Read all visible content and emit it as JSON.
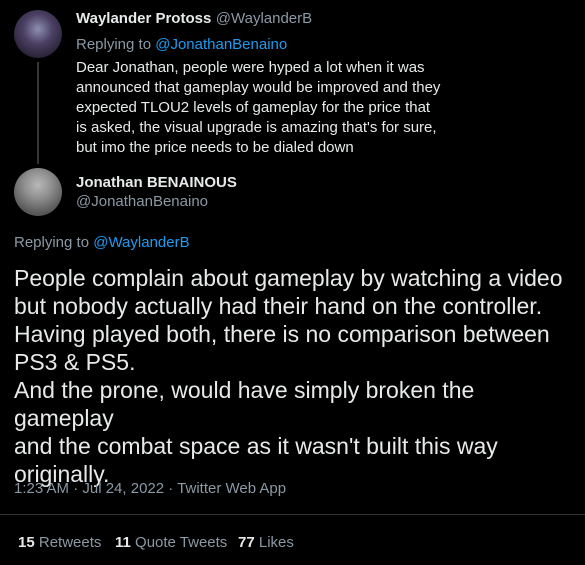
{
  "parent": {
    "name": "Waylander Protoss",
    "handle": "@WaylanderB",
    "replying_prefix": "Replying to ",
    "replying_to": "@JonathanBenaino",
    "text_lines": [
      "Dear Jonathan, people were hyped a lot when it was",
      "announced that gameplay would be improved and they",
      "expected TLOU2 levels of gameplay for the price that",
      "is asked, the visual upgrade is amazing that's for sure,",
      "but imo the price needs to be dialed down"
    ]
  },
  "main": {
    "name": "Jonathan BENAINOUS",
    "handle": "@JonathanBenaino",
    "replying_prefix": "Replying to ",
    "replying_to": "@WaylanderB",
    "text_lines": [
      "People complain about gameplay by watching a video",
      "but nobody actually had their hand on the controller.",
      "Having played both, there is no comparison between",
      "PS3 & PS5.",
      "And the prone, would have simply broken the gameplay",
      "and the combat space as it wasn't built this way",
      "originally."
    ],
    "timestamp": "1:23 AM · Jul 24, 2022 · Twitter Web App"
  },
  "stats": {
    "retweets_count": "15",
    "retweets_label": "Retweets",
    "quotes_count": "11",
    "quotes_label": "Quote Tweets",
    "likes_count": "77",
    "likes_label": "Likes"
  }
}
